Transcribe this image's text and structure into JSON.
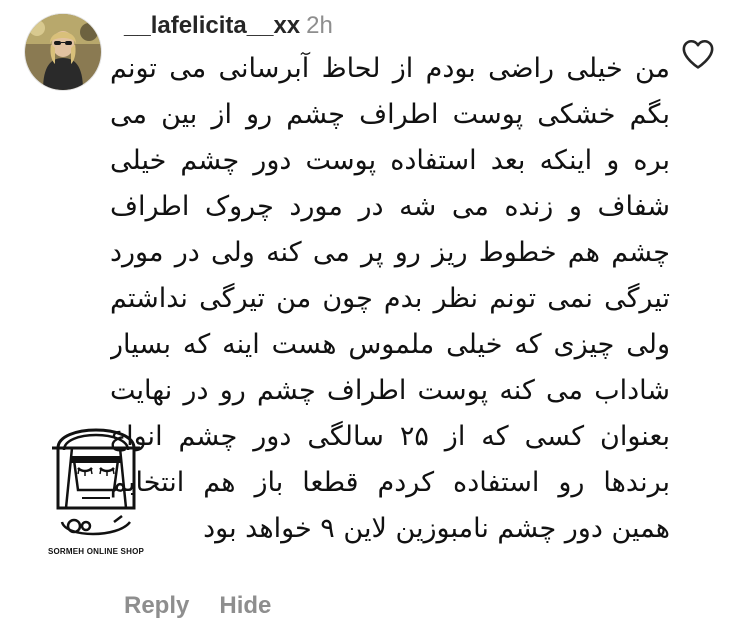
{
  "comment": {
    "username": "__lafelicita__xx",
    "timestamp": "2h",
    "lines": [
      "من خیلی راضی بودم از لحاظ آبرسانی می تونم",
      "بگم خشکی پوست اطراف چشم رو از بین می",
      "بره و اینکه بعد استفاده پوست دور چشم خیلی",
      "شفاف و زنده می شه در مورد چروک اطراف",
      "چشم هم خطوط ریز رو پر می کنه ولی در مورد",
      "تیرگی نمی تونم نظر بدم چون من تیرگی نداشتم",
      "ولی چیزی که خیلی ملموس هست اینه که بسیار",
      "شاداب می کنه پوست اطراف چشم رو در نهایت",
      "بعنوان کسی که از ۲۵ سالگی دور چشم انواع",
      "برندها رو استفاده کردم قطعا باز هم انتخابم",
      "همین دور چشم نامبوزین لاین ۹ خواهد بود"
    ]
  },
  "actions": {
    "reply": "Reply",
    "hide": "Hide"
  },
  "icons": {
    "like": "heart-outline-icon",
    "avatar": "profile-avatar"
  },
  "watermark": {
    "text": "SORMEH ONLINE SHOP"
  },
  "colors": {
    "username": "#262626",
    "secondary": "#8e8e8e",
    "text": "#111111"
  }
}
